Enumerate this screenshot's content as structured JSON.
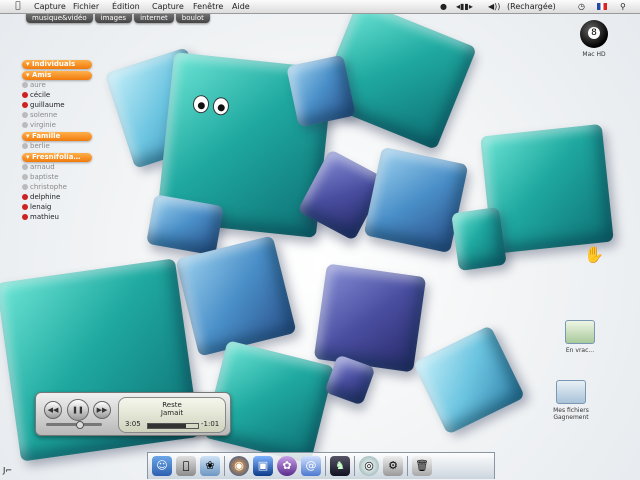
{
  "menubar": {
    "apple": "",
    "menus": [
      "Capture",
      "Fichier",
      "Édition",
      "Capture",
      "Fenêtre",
      "Aide"
    ],
    "tray_play": "◂▮▮▸",
    "tray_volume": "◀))",
    "tray_refresh": "(Rechargée)",
    "tray_clock": "◷"
  },
  "tabs": [
    "musique&vidéo",
    "images",
    "internet",
    "boulot"
  ],
  "contacts": {
    "groups": [
      {
        "name": "Individuals",
        "members": []
      },
      {
        "name": "Amis",
        "members": [
          {
            "name": "aure",
            "online": false
          },
          {
            "name": "cécile",
            "online": true
          },
          {
            "name": "guillaume",
            "online": true
          },
          {
            "name": "solenne",
            "online": false
          },
          {
            "name": "virginie",
            "online": false
          }
        ]
      },
      {
        "name": "Famille",
        "members": [
          {
            "name": "berlie",
            "online": false
          }
        ]
      },
      {
        "name": "Fresnifolia…",
        "members": [
          {
            "name": "arnaud",
            "online": false
          },
          {
            "name": "baptiste",
            "online": false
          },
          {
            "name": "christophe",
            "online": false
          },
          {
            "name": "delphine",
            "online": true
          },
          {
            "name": "lenaig",
            "online": true
          },
          {
            "name": "mathieu",
            "online": true
          }
        ]
      }
    ]
  },
  "desktop_icons": {
    "mac_hd": "Mac HD",
    "en_vrac": "En vrac...",
    "documents": "Mes fichiers Gagnement"
  },
  "itunes": {
    "line1": "Reste",
    "line2": "Jamait",
    "elapsed": "3:05",
    "remaining": "-1:01",
    "progress": 0.75,
    "volume": 0.6
  },
  "dock": [
    "Finder",
    "Système",
    "Applications",
    "Firefox",
    "Photo",
    "Adium",
    "Mail",
    "Jeu",
    "iChat",
    "Préférences",
    "Corbeille"
  ],
  "colors": {
    "accent": "#f07a0c",
    "cube_teal": "#1fa9a0",
    "cube_blue": "#4a8fc8",
    "cube_purple": "#4a4ea0"
  }
}
